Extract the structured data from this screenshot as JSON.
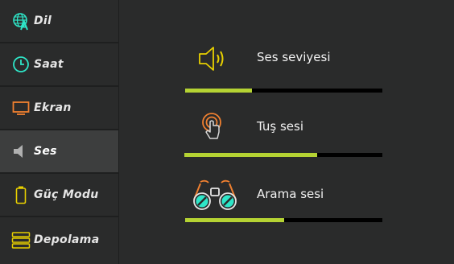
{
  "sidebar": {
    "items": [
      {
        "label": "Dil",
        "icon": "globe-a-icon",
        "active": false
      },
      {
        "label": "Saat",
        "icon": "clock-icon",
        "active": false
      },
      {
        "label": "Ekran",
        "icon": "monitor-icon",
        "active": false
      },
      {
        "label": "Ses",
        "icon": "speaker-icon",
        "active": true
      },
      {
        "label": "Güç Modu",
        "icon": "battery-icon",
        "active": false
      },
      {
        "label": "Depolama",
        "icon": "storage-icon",
        "active": false
      }
    ]
  },
  "settings": {
    "volume": {
      "label": "Ses seviyesi",
      "icon": "speaker-volume-icon",
      "level": 0.34
    },
    "key_sound": {
      "label": "Tuş sesi",
      "icon": "touch-hand-icon",
      "level": 0.67
    },
    "call_sound": {
      "label": "Arama sesi",
      "icon": "binoculars-icon",
      "level": 0.5
    }
  },
  "colors": {
    "accent": "#b5d333",
    "icon_teal": "#2ee6c8",
    "icon_yellow": "#e8d000",
    "icon_orange": "#f08030",
    "background": "#2a2b2b",
    "sidebar_active": "#3d3e3e",
    "track": "#000000"
  }
}
